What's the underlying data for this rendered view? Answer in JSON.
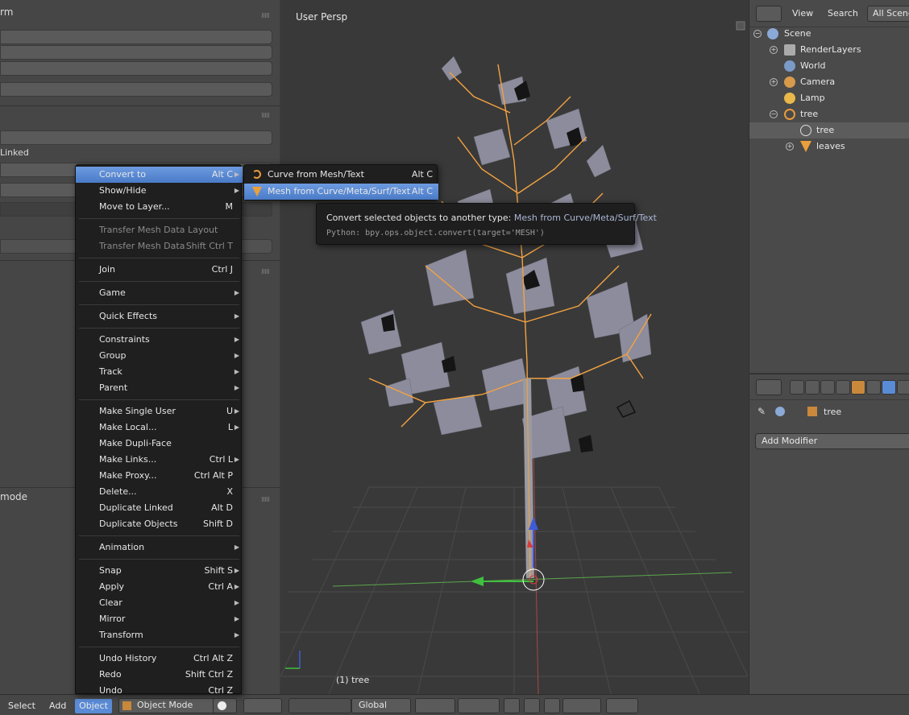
{
  "left_panel": {
    "header_1": "rm",
    "linked_label": "Linked",
    "mode_label": "mode"
  },
  "viewport": {
    "title": "User Persp",
    "status": "(1) tree"
  },
  "outliner": {
    "header": {
      "view": "View",
      "search": "Search",
      "filter": "All Scenes"
    },
    "items": [
      {
        "label": "Scene"
      },
      {
        "label": "RenderLayers"
      },
      {
        "label": "World"
      },
      {
        "label": "Camera"
      },
      {
        "label": "Lamp"
      },
      {
        "label": "tree"
      },
      {
        "label": "tree"
      },
      {
        "label": "leaves"
      }
    ]
  },
  "properties": {
    "object_name": "tree",
    "add_modifier": "Add Modifier"
  },
  "object_menu": {
    "items": [
      {
        "label": "Convert to",
        "shortcut": "Alt C",
        "submenu": true,
        "highlighted": true
      },
      {
        "label": "Show/Hide",
        "shortcut": "",
        "submenu": true
      },
      {
        "label": "Move to Layer...",
        "shortcut": "M"
      },
      {
        "label": "Transfer Mesh Data Layout",
        "shortcut": "",
        "disabled": true
      },
      {
        "label": "Transfer Mesh Data",
        "shortcut": "Shift Ctrl T",
        "disabled": true
      },
      {
        "label": "Join",
        "shortcut": "Ctrl J"
      },
      {
        "label": "Game",
        "shortcut": "",
        "submenu": true
      },
      {
        "label": "Quick Effects",
        "shortcut": "",
        "submenu": true
      },
      {
        "label": "Constraints",
        "shortcut": "",
        "submenu": true
      },
      {
        "label": "Group",
        "shortcut": "",
        "submenu": true
      },
      {
        "label": "Track",
        "shortcut": "",
        "submenu": true
      },
      {
        "label": "Parent",
        "shortcut": "",
        "submenu": true
      },
      {
        "label": "Make Single User",
        "shortcut": "U",
        "submenu": true
      },
      {
        "label": "Make Local...",
        "shortcut": "L",
        "submenu": true
      },
      {
        "label": "Make Dupli-Face",
        "shortcut": ""
      },
      {
        "label": "Make Links...",
        "shortcut": "Ctrl L",
        "submenu": true
      },
      {
        "label": "Make Proxy...",
        "shortcut": "Ctrl Alt P"
      },
      {
        "label": "Delete...",
        "shortcut": "X"
      },
      {
        "label": "Duplicate Linked",
        "shortcut": "Alt D"
      },
      {
        "label": "Duplicate Objects",
        "shortcut": "Shift D"
      },
      {
        "label": "Animation",
        "shortcut": "",
        "submenu": true
      },
      {
        "label": "Snap",
        "shortcut": "Shift S",
        "submenu": true
      },
      {
        "label": "Apply",
        "shortcut": "Ctrl A",
        "submenu": true
      },
      {
        "label": "Clear",
        "shortcut": "",
        "submenu": true
      },
      {
        "label": "Mirror",
        "shortcut": "",
        "submenu": true
      },
      {
        "label": "Transform",
        "shortcut": "",
        "submenu": true
      },
      {
        "label": "Undo History",
        "shortcut": "Ctrl Alt Z"
      },
      {
        "label": "Redo",
        "shortcut": "Shift Ctrl Z"
      },
      {
        "label": "Undo",
        "shortcut": "Ctrl Z"
      }
    ]
  },
  "convert_submenu": {
    "items": [
      {
        "label": "Curve from Mesh/Text",
        "shortcut": "Alt C",
        "icon": "curve-icon"
      },
      {
        "label": "Mesh from Curve/Meta/Surf/Text",
        "shortcut": "Alt C",
        "icon": "mesh-icon",
        "highlighted": true
      }
    ]
  },
  "tooltip": {
    "description": "Convert selected objects to another type:",
    "value": "Mesh from Curve/Meta/Surf/Text",
    "python": "Python: bpy.ops.object.convert(target='MESH')"
  },
  "bottom_bar": {
    "select": "Select",
    "add": "Add",
    "object": "Object",
    "mode": "Object Mode",
    "orientation": "Global"
  },
  "colors": {
    "menu_highlight": "#5a8bd6",
    "selection_outline": "#f5a340",
    "background": "#393939"
  }
}
